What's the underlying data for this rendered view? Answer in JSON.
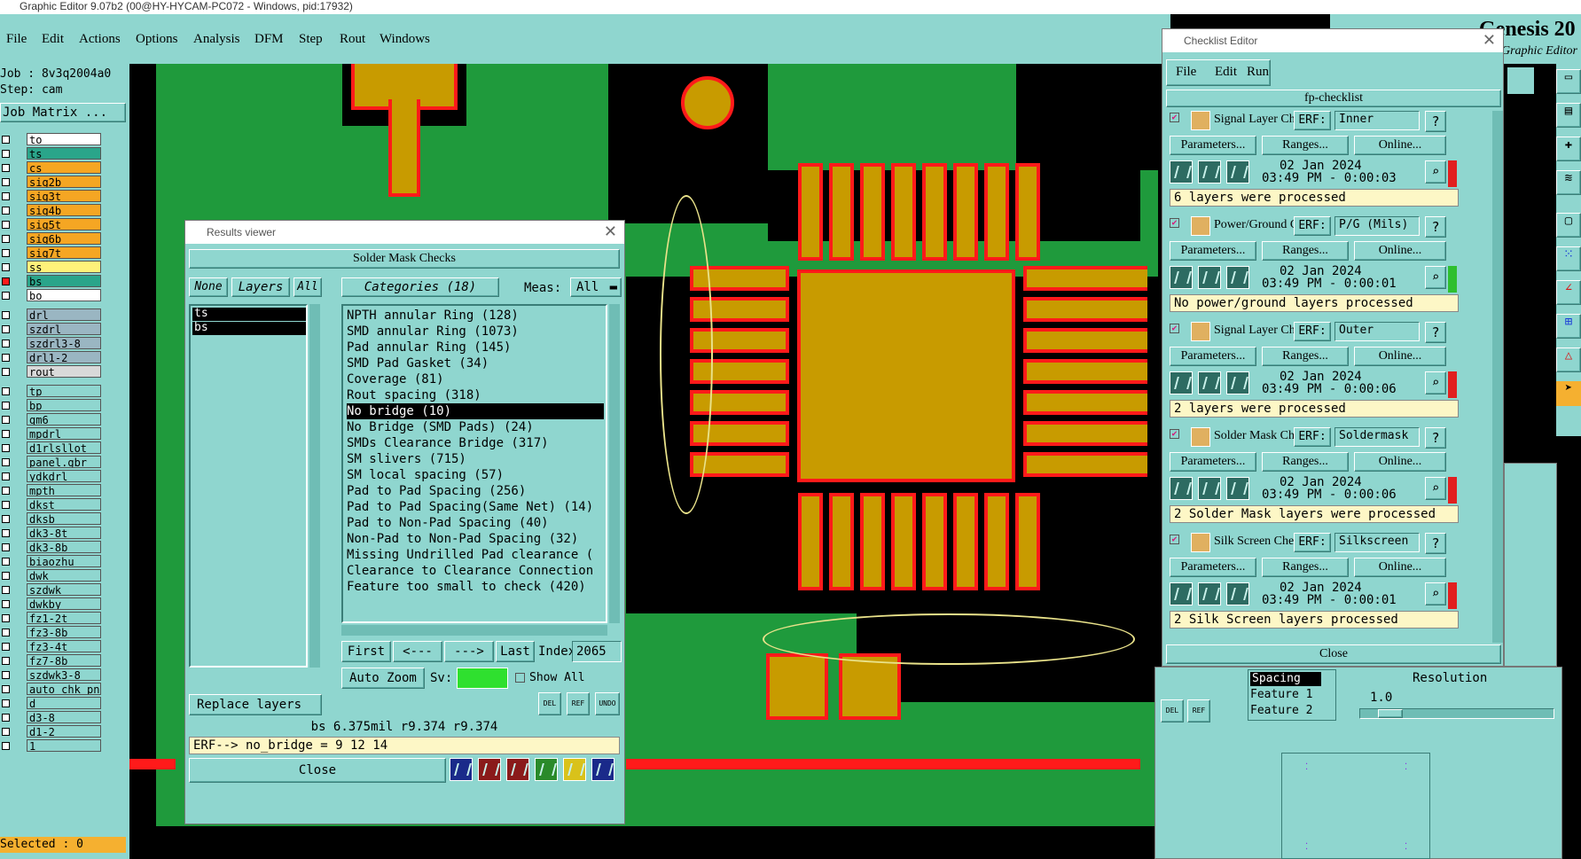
{
  "app": {
    "title": "Graphic Editor 9.07b2 (00@HY-HYCAM-PC072 - Windows, pid:17932)",
    "brand": "Genesis 20",
    "brand_sub": "Graphic Editor"
  },
  "menu": [
    "File",
    "Edit",
    "Actions",
    "Options",
    "Analysis",
    "DFM",
    "Step",
    "Rout",
    "Windows"
  ],
  "job": {
    "job_label": "Job : 8v3q2004a0",
    "step_label": "Step: cam",
    "matrix_button": "Job Matrix ..."
  },
  "layers": [
    {
      "name": "to",
      "color": "#ffffff"
    },
    {
      "name": "ts",
      "color": "#2aa58a"
    },
    {
      "name": "cs",
      "color": "#f5a623"
    },
    {
      "name": "sig2b",
      "color": "#f5a623"
    },
    {
      "name": "sig3t",
      "color": "#f5a623"
    },
    {
      "name": "sig4b",
      "color": "#f5a623"
    },
    {
      "name": "sig5t",
      "color": "#f5a623"
    },
    {
      "name": "sig6b",
      "color": "#f5a623"
    },
    {
      "name": "sig7t",
      "color": "#f5a623"
    },
    {
      "name": "ss",
      "color": "#fff27a"
    },
    {
      "name": "bs",
      "color": "#2aa58a"
    },
    {
      "name": "bo",
      "color": "#ffffff"
    },
    {
      "name": "drl",
      "color": "#9ab6c2"
    },
    {
      "name": "szdrl",
      "color": "#9ab6c2"
    },
    {
      "name": "szdrl3-8",
      "color": "#9ab6c2"
    },
    {
      "name": "drl1-2",
      "color": "#9ab6c2"
    },
    {
      "name": "rout",
      "color": "#d9d9d9"
    },
    {
      "name": "tp",
      "color": "#8fd6cf"
    },
    {
      "name": "bp",
      "color": "#8fd6cf"
    },
    {
      "name": "gm6",
      "color": "#8fd6cf"
    },
    {
      "name": "mpdrl",
      "color": "#8fd6cf"
    },
    {
      "name": "d1rlsllot",
      "color": "#8fd6cf"
    },
    {
      "name": "panel.gbr",
      "color": "#8fd6cf"
    },
    {
      "name": "ydkdrl",
      "color": "#8fd6cf"
    },
    {
      "name": "mpth",
      "color": "#8fd6cf"
    },
    {
      "name": "dkst",
      "color": "#8fd6cf"
    },
    {
      "name": "dksb",
      "color": "#8fd6cf"
    },
    {
      "name": "dk3-8t",
      "color": "#8fd6cf"
    },
    {
      "name": "dk3-8b",
      "color": "#8fd6cf"
    },
    {
      "name": "biaozhu",
      "color": "#8fd6cf"
    },
    {
      "name": "dwk",
      "color": "#8fd6cf"
    },
    {
      "name": "szdwk",
      "color": "#8fd6cf"
    },
    {
      "name": "dwkby",
      "color": "#8fd6cf"
    },
    {
      "name": "fz1-2t",
      "color": "#8fd6cf"
    },
    {
      "name": "fz3-8b",
      "color": "#8fd6cf"
    },
    {
      "name": "fz3-4t",
      "color": "#8fd6cf"
    },
    {
      "name": "fz7-8b",
      "color": "#8fd6cf"
    },
    {
      "name": "szdwk3-8",
      "color": "#8fd6cf"
    },
    {
      "name": "auto_chk_pn",
      "color": "#8fd6cf"
    },
    {
      "name": "d",
      "color": "#8fd6cf"
    },
    {
      "name": "d3-8",
      "color": "#8fd6cf"
    },
    {
      "name": "d1-2",
      "color": "#8fd6cf"
    },
    {
      "name": "1",
      "color": "#8fd6cf"
    }
  ],
  "selected_label": "Selected : 0",
  "results": {
    "window_title": "Results viewer",
    "header": "Solder Mask Checks",
    "none_btn": "None",
    "layers_btn": "Layers",
    "all_btn": "All",
    "categories_btn": "Categories (18)",
    "meas_label": "Meas:",
    "meas_value": "All",
    "layer_items": [
      "ts",
      "bs"
    ],
    "categories": [
      "NPTH annular Ring (128)",
      "SMD annular Ring (1073)",
      "Pad annular Ring (145)",
      "SMD Pad Gasket (34)",
      "Coverage (81)",
      "Rout spacing (318)",
      "No bridge (10)",
      "No Bridge (SMD Pads) (24)",
      "SMDs Clearance Bridge (317)",
      "SM slivers (715)",
      "SM local spacing (57)",
      "Pad to Pad Spacing (256)",
      "Pad to Pad Spacing(Same Net) (14)",
      "Pad to Non-Pad Spacing (40)",
      "Non-Pad to Non-Pad Spacing (32)",
      "Missing Undrilled Pad clearance (",
      "Clearance to Clearance Connection",
      "Feature too small to check (420)"
    ],
    "selected_index": 6,
    "first_btn": "First",
    "prev_btn": "<---",
    "next_btn": "--->",
    "last_btn": "Last",
    "index_label": "Index:",
    "index_value": "2065",
    "autozoom_btn": "Auto Zoom",
    "sv_label": "Sv:",
    "show_all_label": "Show All",
    "replace_btn": "Replace layers",
    "del_label": "DEL",
    "ref_label": "REF",
    "undo_label": "UNDO",
    "info_line": "bs 6.375mil  r9.374  r9.374",
    "erf_line": "ERF--> no_bridge = 9 12 14",
    "close_btn": "Close"
  },
  "checklist": {
    "window_title": "Checklist Editor",
    "menu": [
      "File",
      "Edit",
      "Run"
    ],
    "name": "fp-checklist",
    "params_label": "Parameters...",
    "ranges_label": "Ranges...",
    "online_label": "Online...",
    "erf_label": "ERF:",
    "rows": [
      {
        "title": "Signal Layer Ch",
        "erf": "Inner",
        "date": "02 Jan 2024",
        "time": "03:49 PM - 0:00:03",
        "status": "6 layers were processed",
        "flag": "#e11f1f"
      },
      {
        "title": "Power/Ground C",
        "erf": "P/G (Mils)",
        "date": "02 Jan 2024",
        "time": "03:49 PM - 0:00:01",
        "status": "No power/ground layers processed",
        "flag": "#2fbf2f"
      },
      {
        "title": "Signal Layer Ch",
        "erf": "Outer",
        "date": "02 Jan 2024",
        "time": "03:49 PM - 0:00:06",
        "status": "2 layers were processed",
        "flag": "#e11f1f"
      },
      {
        "title": "Solder Mask Ch",
        "erf": "Soldermask",
        "date": "02 Jan 2024",
        "time": "03:49 PM - 0:00:06",
        "status": "2 Solder Mask layers were processed",
        "flag": "#e11f1f"
      },
      {
        "title": "Silk Screen Che",
        "erf": "Silkscreen",
        "date": "02 Jan 2024",
        "time": "03:49 PM - 0:00:01",
        "status": "2 Silk Screen layers processed",
        "flag": "#e11f1f"
      }
    ],
    "close_btn": "Close"
  },
  "lower_right": {
    "spacing_items": [
      "Spacing",
      "Feature 1",
      "Feature 2"
    ],
    "resolution_label": "Resolution",
    "resolution_value": "1.0",
    "del_label": "DEL",
    "ref_label": "REF"
  },
  "colors": {
    "panel": "#8fd6cf",
    "pcb_green": "#1f9a3c",
    "pad": "#c89b00",
    "pad_border": "#ff1a1a",
    "highlight": "#fdf7c6"
  }
}
